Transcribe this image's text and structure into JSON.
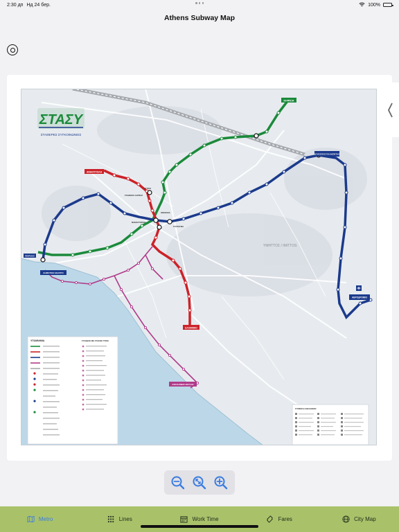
{
  "status": {
    "time": "2:30 дп",
    "date": "Нд 24 бер.",
    "battery": "100%"
  },
  "nav": {
    "title": "Athens Subway Map"
  },
  "map": {
    "logo_text": "ΣΤΑΣΥ",
    "logo_subtitle": "ΣΤΑΘΕΡΕΣ ΣΥΓΚΟΙΝΩΝΙΕΣ",
    "stations": {
      "kifisia": "ΚΗΦΙΣΙΑ",
      "anthoupoli": "ΑΝΘΟΥΠΟΛΗ",
      "omonia": "ΟΜΟΝΟΙΑ",
      "syntagma": "ΣΥΝΤΑΓΜΑ",
      "monastiraki": "ΜΟΝΑΣΤΗΡΑΚΙ",
      "larissa": "ΣΤΑΘΜΟΣ ΛΑΡΙΣΗΣ",
      "attiki": "ΑΤΤΙΚΗ",
      "piraeus": "ΠΕΙΡΑΙΑΣ",
      "dim_theatro": "ΔΗΜΟΤΙΚΟ ΘΕΑΤΡΟ",
      "elliniko": "ΕΛΛΗΝΙΚΟ",
      "douk_plakentias": "ΔΟΥΚΙΣΣΗΣ ΠΛΑΚΕΝΤΙΑΣ",
      "airport": "ΑΕΡΟΔΡΟΜΙΟ",
      "asklipiio": "ΑΣΚΛΗΠΙΕΙΟ ΒΟΥΛΑΣ",
      "ymittos": "ΥΜΗΤΤΟΣ / IMITTOS",
      "anthoupoli_sub": "ΑΝΘΟΥΠΟΛΗ"
    },
    "legend_title": "ΥΠΟΜΝΗΜΑ",
    "legend2_title": "ΣΥΝΔΕΣΗ ΜΕ ΣΤΑΣΕΙΣ ΤΡΑΜ",
    "legend3_title": "ΣΥΜΒΟΛΑ ΦΩΛΙΑΦΩΝ"
  },
  "zoom": {
    "zoom_out": "zoom-out",
    "zoom_reset": "zoom-reset",
    "zoom_in": "zoom-in"
  },
  "tabs": [
    {
      "label": "Metro",
      "icon": "map-icon",
      "active": true
    },
    {
      "label": "Lines",
      "icon": "lines-icon",
      "active": false
    },
    {
      "label": "Work Time",
      "icon": "calendar-icon",
      "active": false
    },
    {
      "label": "Fares",
      "icon": "ticket-icon",
      "active": false
    },
    {
      "label": "City Map",
      "icon": "globe-icon",
      "active": false
    }
  ],
  "colors": {
    "line1": "#1a8a3a",
    "line2": "#cc2229",
    "line3": "#1b3a8c",
    "tram": "#b03a8a",
    "sea": "#bcd8e8",
    "accent": "#3a7be0",
    "tabbar": "#a9c26a"
  }
}
